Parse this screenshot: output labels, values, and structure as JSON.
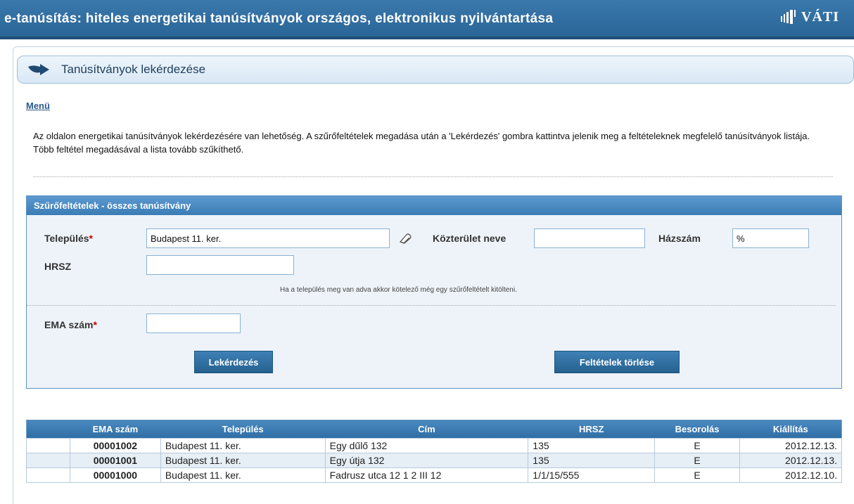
{
  "app": {
    "title": "e-tanúsítás: hiteles energetikai tanúsítványok országos, elektronikus nyilvántartása",
    "logo_text": "VÁTI"
  },
  "page": {
    "title": "Tanúsítványok lekérdezése",
    "menu_link": "Menü",
    "intro": "Az oldalon energetikai tanúsítványok lekérdezésére van lehetőség. A szűrőfeltételek megadása után a 'Lekérdezés' gombra kattintva jelenik meg a feltételeknek megfelelő tanúsítványok listája. Több feltétel megadásával a lista tovább szűkíthető."
  },
  "filter": {
    "title": "Szűrőfeltételek - összes tanúsítvány",
    "telepules_label": "Település",
    "telepules_value": "Budapest 11. ker.",
    "kozterulet_label": "Közterület neve",
    "kozterulet_value": "",
    "hazszam_label": "Házszám",
    "hazszam_value": "%",
    "hrsz_label": "HRSZ",
    "hrsz_value": "",
    "hint": "Ha a település meg van adva akkor kötelező még egy szűrőfeltételt kitölteni.",
    "ema_label": "EMA szám",
    "ema_value": "",
    "required_mark": "*",
    "query_button": "Lekérdezés",
    "clear_button": "Feltételek törlése"
  },
  "results": {
    "columns": [
      "",
      "EMA szám",
      "Település",
      "Cím",
      "HRSZ",
      "Besorolás",
      "Kiállítás"
    ],
    "rows": [
      {
        "ema": "00001002",
        "telepules": "Budapest 11. ker.",
        "cim": "Egy dűlő 132",
        "hrsz": "135",
        "besorolas": "E",
        "kiallitas": "2012.12.13."
      },
      {
        "ema": "00001001",
        "telepules": "Budapest 11. ker.",
        "cim": "Egy útja 132",
        "hrsz": "135",
        "besorolas": "E",
        "kiallitas": "2012.12.13."
      },
      {
        "ema": "00001000",
        "telepules": "Budapest 11. ker.",
        "cim": "Fadrusz utca 12 1 2 III 12",
        "hrsz": "1/1/15/555",
        "besorolas": "E",
        "kiallitas": "2012.12.10."
      }
    ]
  },
  "icons": {
    "header_arrow": "arrow-right-icon",
    "eraser": "eraser-icon",
    "logo": "vati-logo-icon"
  },
  "colors": {
    "topbar": "#2f6c9f",
    "panel_head": "#4a89bf",
    "required": "#cc0000"
  }
}
